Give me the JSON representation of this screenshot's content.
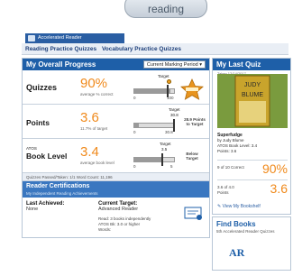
{
  "top": {
    "reading_button": "reading"
  },
  "app_tab": {
    "label": "Accelerated Reader"
  },
  "nav": {
    "items": [
      {
        "label": "Reading Practice Quizzes"
      },
      {
        "label": "Vocabulary Practice Quizzes"
      }
    ]
  },
  "progress": {
    "title": "My Overall Progress",
    "period_select": "Current Marking Period ▾",
    "quizzes": {
      "label": "Quizzes",
      "value": "90%",
      "sub": "average % correct",
      "target_label": "Target",
      "target_value": "85",
      "axis_min": "0",
      "axis_max": "100",
      "fill_fraction": 0.9,
      "target_fraction": 0.85
    },
    "points": {
      "label": "Points",
      "value": "3.6",
      "sub": "11.7% of target",
      "target_label": "Target",
      "target_value": "30.8",
      "axis_min": "0",
      "axis_max": "30.8",
      "fill_fraction": 0.117,
      "target_fraction": 1.0,
      "note": "28.9 Points to Target"
    },
    "book_level": {
      "prefix": "ATOS",
      "label": "Book Level",
      "value": "3.4",
      "sub": "average book level",
      "target_label": "Target",
      "target_value": "3.5",
      "axis_min": "0",
      "axis_max": "5",
      "fill_fraction": 0.68,
      "target_fraction": 0.7,
      "note": "Below Target"
    },
    "footer": "Quizzes Passed/Taken: 1/1   Word Count: 11,196"
  },
  "certs": {
    "title": "Reader Certifications",
    "subtitle": "My Independent Reading Achievements",
    "last_achieved_label": "Last Achieved:",
    "last_achieved_value": "None",
    "current_target_label": "Current Target:",
    "current_target_value": "Advanced Reader",
    "detail_read": "Read: 3 books independently",
    "detail_atos": "ATOS Bk: 3.0 or higher",
    "detail_words": "Words:"
  },
  "last_quiz": {
    "title": "My Last Quiz",
    "date": "Taken 12/14/2017",
    "book_title": "Superfudge",
    "book_author": "by Judy Blume",
    "book_level": "ATOS Book Level: 3.4",
    "book_points": "Points: 3.6",
    "correct_label": "9 of 10 Correct",
    "correct_value": "90%",
    "points_label_1": "3.6 of 4.0",
    "points_label_2": "Points",
    "points_value": "3.6",
    "bookshelf_link": "View My Bookshelf"
  },
  "find_books": {
    "title": "Find Books",
    "subtitle": "5th Accelerated Reader Quizzes",
    "logo": "AR"
  }
}
